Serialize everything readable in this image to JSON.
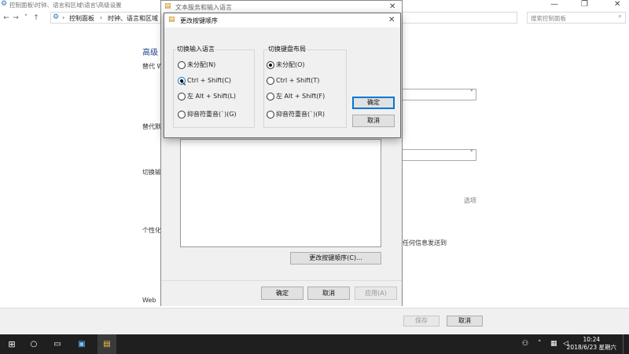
{
  "main_window": {
    "title": "控制面板\\时钟、语言和区域\\语言\\高级设置",
    "breadcrumb": [
      "控制面板",
      "时钟、语言和区域"
    ],
    "breadcrumb_sep": "›",
    "search_placeholder": "搜索控制面板",
    "heading_fragment": "高级",
    "labels": {
      "override_lang": "替代 W",
      "override_default": "替代默",
      "switch_input": "切换输",
      "personalize": "个性化",
      "web": "Web",
      "options_link": "选项",
      "send_info": "任何信息发送到"
    },
    "buttons": {
      "save": "保存",
      "cancel": "取消"
    }
  },
  "text_services_window": {
    "title": "文本服务和输入语言",
    "change_sequence_button": "更改按键顺序(C)...",
    "buttons": {
      "ok": "确定",
      "cancel": "取消",
      "apply": "应用(A)"
    }
  },
  "dialog": {
    "title": "更改按键顺序",
    "input_language_group": {
      "label": "切换输入语言",
      "options": [
        "未分配(N)",
        "Ctrl + Shift(C)",
        "左 Alt + Shift(L)",
        "抑音符重音(`)(G)"
      ],
      "selected": 1
    },
    "keyboard_layout_group": {
      "label": "切换键盘布局",
      "options": [
        "未分配(O)",
        "Ctrl + Shift(T)",
        "左 Alt + Shift(F)",
        "抑音符重音(`)(R)"
      ],
      "selected": 0
    },
    "buttons": {
      "ok": "确定",
      "cancel": "取消"
    }
  },
  "taskbar": {
    "time": "10:24",
    "date": "2018/6/23 星期六"
  },
  "colors": {
    "taskbar": "#1f1f1f",
    "accent": "#0078d7"
  }
}
